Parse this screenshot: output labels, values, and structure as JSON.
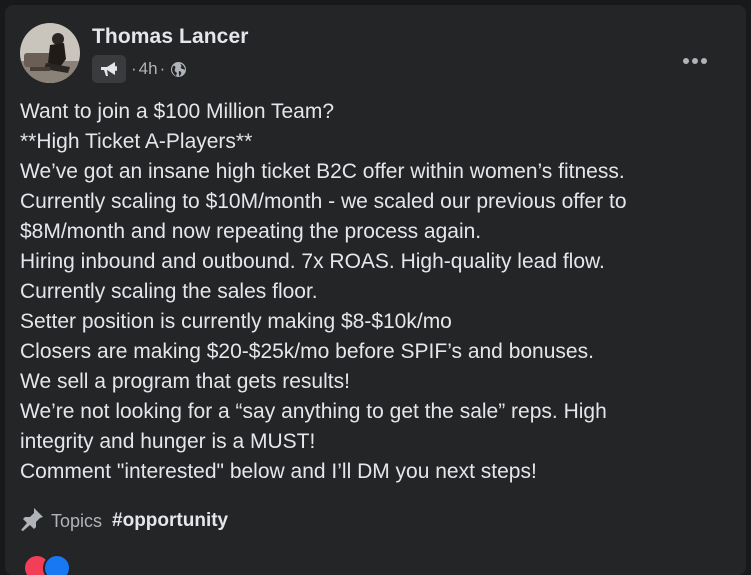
{
  "post": {
    "author": "Thomas Lancer",
    "time": "4h",
    "separator": "·",
    "icons": {
      "badge": "megaphone-icon",
      "audience": "globe-icon",
      "more": "more-options-icon",
      "topics": "pin-icon"
    },
    "lines": [
      "Want to join a $100 Million Team?",
      "**High Ticket A-Players**",
      "We’ve got an insane high ticket B2C offer within women’s fitness.",
      "Currently scaling to $10M/month - we scaled our previous offer to",
      "$8M/month and now repeating the process again.",
      "Hiring inbound and outbound. 7x ROAS. High-quality lead flow.",
      "Currently scaling the sales floor.",
      "Setter position is currently making $8-$10k/mo",
      "Closers are making $20-$25k/mo before SPIF’s and bonuses.",
      "We sell a program that gets results!",
      "We’re not looking for a “say anything to get the sale” reps. High",
      "integrity and hunger is a MUST!",
      "Comment \"interested\" below and I’ll DM you next steps!"
    ],
    "topics_label": "Topics",
    "hashtag": "#opportunity"
  },
  "colors": {
    "card_bg": "#242526",
    "page_bg": "#18191a",
    "primary_text": "#e4e6eb",
    "secondary_text": "#b0b3b8",
    "reaction_love": "#f33e58",
    "reaction_like": "#1877f2"
  }
}
